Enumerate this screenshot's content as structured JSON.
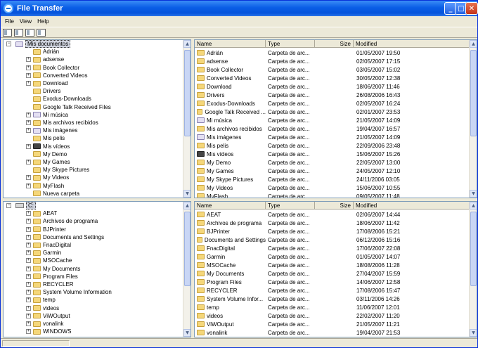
{
  "window": {
    "title": "File Transfer"
  },
  "menu": [
    "File",
    "View",
    "Help"
  ],
  "toolbar": {
    "buttons": [
      "view-icons",
      "view-list",
      "view-details",
      "view-thumbnails"
    ]
  },
  "local_tree": {
    "root": "Mis documentos",
    "items": [
      {
        "label": "Adrián",
        "icon": "folder",
        "expander": false
      },
      {
        "label": "adsense",
        "icon": "folder",
        "expander": true
      },
      {
        "label": "Book Collector",
        "icon": "folder",
        "expander": true
      },
      {
        "label": "Converted Videos",
        "icon": "folder",
        "expander": true
      },
      {
        "label": "Download",
        "icon": "folder",
        "expander": true
      },
      {
        "label": "Drivers",
        "icon": "folder",
        "expander": false
      },
      {
        "label": "Exodus-Downloads",
        "icon": "folder",
        "expander": false
      },
      {
        "label": "Google Talk Received Files",
        "icon": "folder",
        "expander": false
      },
      {
        "label": "Mi música",
        "icon": "special",
        "expander": true
      },
      {
        "label": "Mis archivos recibidos",
        "icon": "folder",
        "expander": true
      },
      {
        "label": "Mis imágenes",
        "icon": "special",
        "expander": true
      },
      {
        "label": "Mis pelis",
        "icon": "folder",
        "expander": false
      },
      {
        "label": "Mis vídeos",
        "icon": "video",
        "expander": true
      },
      {
        "label": "My Demo",
        "icon": "folder",
        "expander": false
      },
      {
        "label": "My Games",
        "icon": "folder",
        "expander": true
      },
      {
        "label": "My Skype Pictures",
        "icon": "folder",
        "expander": false
      },
      {
        "label": "My Videos",
        "icon": "folder",
        "expander": true
      },
      {
        "label": "MyFlash",
        "icon": "folder",
        "expander": true
      },
      {
        "label": "Nueva carpeta",
        "icon": "folder",
        "expander": false
      }
    ]
  },
  "remote_tree": {
    "root": "C:",
    "items": [
      {
        "label": "AEAT",
        "icon": "folder",
        "expander": true
      },
      {
        "label": "Archivos de programa",
        "icon": "folder",
        "expander": true
      },
      {
        "label": "BJPrinter",
        "icon": "folder",
        "expander": true
      },
      {
        "label": "Documents and Settings",
        "icon": "folder",
        "expander": true
      },
      {
        "label": "FnacDigital",
        "icon": "folder",
        "expander": true
      },
      {
        "label": "Garmin",
        "icon": "folder",
        "expander": true
      },
      {
        "label": "MSOCache",
        "icon": "folder",
        "expander": true
      },
      {
        "label": "My Documents",
        "icon": "folder",
        "expander": true
      },
      {
        "label": "Program Files",
        "icon": "folder",
        "expander": true
      },
      {
        "label": "RECYCLER",
        "icon": "folder",
        "expander": true
      },
      {
        "label": "System Volume Information",
        "icon": "folder",
        "expander": true
      },
      {
        "label": "temp",
        "icon": "folder",
        "expander": true
      },
      {
        "label": "videos",
        "icon": "folder",
        "expander": true
      },
      {
        "label": "ViWOutput",
        "icon": "folder",
        "expander": true
      },
      {
        "label": "vonalink",
        "icon": "folder",
        "expander": true
      },
      {
        "label": "WINDOWS",
        "icon": "folder",
        "expander": true
      }
    ]
  },
  "columns": {
    "name": "Name",
    "type": "Type",
    "size": "Size",
    "modified": "Modified"
  },
  "local_files": [
    {
      "name": "Adrián",
      "icon": "folder",
      "type": "Carpeta de arc...",
      "modified": "01/05/2007 19:50"
    },
    {
      "name": "adsense",
      "icon": "folder",
      "type": "Carpeta de arc...",
      "modified": "02/05/2007 17:15"
    },
    {
      "name": "Book Collector",
      "icon": "folder",
      "type": "Carpeta de arc...",
      "modified": "03/05/2007 15:02"
    },
    {
      "name": "Converted Videos",
      "icon": "folder",
      "type": "Carpeta de arc...",
      "modified": "30/05/2007 12:38"
    },
    {
      "name": "Download",
      "icon": "folder",
      "type": "Carpeta de arc...",
      "modified": "18/06/2007 11:46"
    },
    {
      "name": "Drivers",
      "icon": "folder",
      "type": "Carpeta de arc...",
      "modified": "26/08/2006 16:43"
    },
    {
      "name": "Exodus-Downloads",
      "icon": "folder",
      "type": "Carpeta de arc...",
      "modified": "02/05/2007 16:24"
    },
    {
      "name": "Google Talk Received ...",
      "icon": "folder",
      "type": "Carpeta de arc...",
      "modified": "02/01/2007 23:53"
    },
    {
      "name": "Mi música",
      "icon": "special",
      "type": "Carpeta de arc...",
      "modified": "21/05/2007 14:09"
    },
    {
      "name": "Mis archivos recibidos",
      "icon": "folder",
      "type": "Carpeta de arc...",
      "modified": "19/04/2007 16:57"
    },
    {
      "name": "Mis imágenes",
      "icon": "special",
      "type": "Carpeta de arc...",
      "modified": "21/05/2007 14:09"
    },
    {
      "name": "Mis pelis",
      "icon": "folder",
      "type": "Carpeta de arc...",
      "modified": "22/09/2006 23:48"
    },
    {
      "name": "Mis vídeos",
      "icon": "video",
      "type": "Carpeta de arc...",
      "modified": "15/06/2007 15:26"
    },
    {
      "name": "My Demo",
      "icon": "folder",
      "type": "Carpeta de arc...",
      "modified": "22/05/2007 13:00"
    },
    {
      "name": "My Games",
      "icon": "folder",
      "type": "Carpeta de arc...",
      "modified": "24/05/2007 12:10"
    },
    {
      "name": "My Skype Pictures",
      "icon": "folder",
      "type": "Carpeta de arc...",
      "modified": "24/11/2006 03:05"
    },
    {
      "name": "My Videos",
      "icon": "folder",
      "type": "Carpeta de arc...",
      "modified": "15/06/2007 10:55"
    },
    {
      "name": "MyFlash",
      "icon": "folder",
      "type": "Carpeta de arc...",
      "modified": "09/05/2007 11:48"
    }
  ],
  "remote_files": [
    {
      "name": "AEAT",
      "icon": "folder",
      "type": "Carpeta de arc...",
      "modified": "02/06/2007 14:44"
    },
    {
      "name": "Archivos de programa",
      "icon": "folder",
      "type": "Carpeta de arc...",
      "modified": "18/06/2007 11:42"
    },
    {
      "name": "BJPrinter",
      "icon": "folder",
      "type": "Carpeta de arc...",
      "modified": "17/08/2006 15:21"
    },
    {
      "name": "Documents and Settings",
      "icon": "folder",
      "type": "Carpeta de arc...",
      "modified": "06/12/2006 15:16"
    },
    {
      "name": "FnacDigital",
      "icon": "folder",
      "type": "Carpeta de arc...",
      "modified": "17/06/2007 22:08"
    },
    {
      "name": "Garmin",
      "icon": "folder",
      "type": "Carpeta de arc...",
      "modified": "01/05/2007 14:07"
    },
    {
      "name": "MSOCache",
      "icon": "folder",
      "type": "Carpeta de arc...",
      "modified": "18/08/2006 11:28"
    },
    {
      "name": "My Documents",
      "icon": "folder",
      "type": "Carpeta de arc...",
      "modified": "27/04/2007 15:59"
    },
    {
      "name": "Program Files",
      "icon": "folder",
      "type": "Carpeta de arc...",
      "modified": "14/06/2007 12:58"
    },
    {
      "name": "RECYCLER",
      "icon": "folder",
      "type": "Carpeta de arc...",
      "modified": "17/08/2006 15:47"
    },
    {
      "name": "System Volume Infor...",
      "icon": "folder",
      "type": "Carpeta de arc...",
      "modified": "03/11/2006 14:26"
    },
    {
      "name": "temp",
      "icon": "folder",
      "type": "Carpeta de arc...",
      "modified": "11/06/2007 12:01"
    },
    {
      "name": "videos",
      "icon": "folder",
      "type": "Carpeta de arc...",
      "modified": "22/02/2007 11:20"
    },
    {
      "name": "ViWOutput",
      "icon": "folder",
      "type": "Carpeta de arc...",
      "modified": "21/05/2007 11:21"
    },
    {
      "name": "vonalink",
      "icon": "folder",
      "type": "Carpeta de arc...",
      "modified": "19/04/2007 21:53"
    }
  ]
}
